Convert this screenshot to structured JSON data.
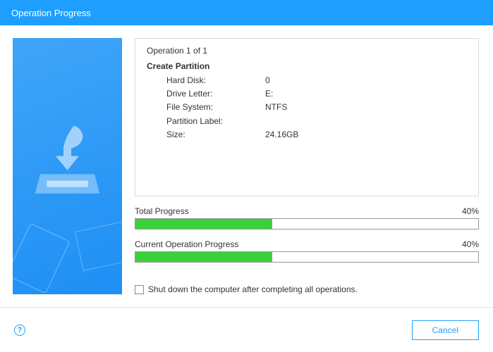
{
  "window": {
    "title": "Operation Progress"
  },
  "sidebar": {
    "icon_name": "download-to-disk-icon"
  },
  "operation": {
    "counter": "Operation 1 of 1",
    "title": "Create Partition",
    "fields": [
      {
        "key": "Hard Disk:",
        "value": "0"
      },
      {
        "key": "Drive Letter:",
        "value": "E:"
      },
      {
        "key": "File System:",
        "value": "NTFS"
      },
      {
        "key": "Partition Label:",
        "value": ""
      },
      {
        "key": "Size:",
        "value": "24.16GB"
      }
    ]
  },
  "progress": {
    "total": {
      "label": "Total Progress",
      "percent_text": "40%",
      "percent": 40
    },
    "current": {
      "label": "Current Operation Progress",
      "percent_text": "40%",
      "percent": 40
    }
  },
  "shutdown": {
    "label": "Shut down the computer after completing all operations.",
    "checked": false
  },
  "buttons": {
    "cancel": "Cancel"
  },
  "colors": {
    "accent": "#1e9fff",
    "progress_fill": "#3ccf3c"
  }
}
